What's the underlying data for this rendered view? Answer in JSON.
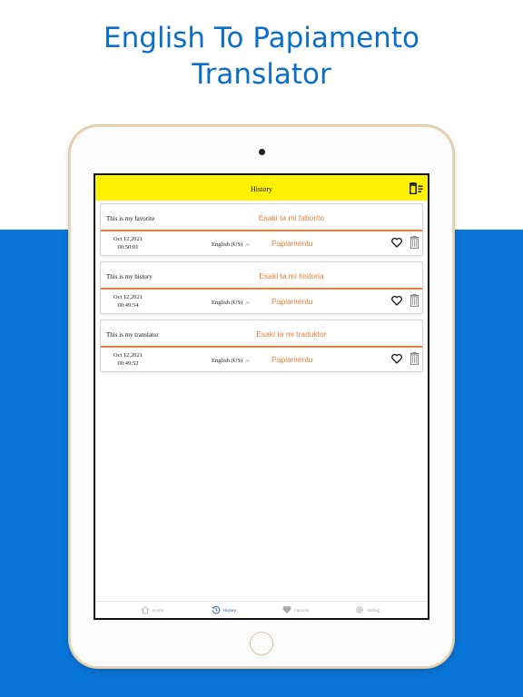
{
  "headline": {
    "line1": "English To Papiamento",
    "line2": "Translator"
  },
  "app": {
    "title": "History"
  },
  "history": [
    {
      "source": "This is my favorite",
      "translation": "Esaki ta mi faborito",
      "date": "Oct 12,2021",
      "time": "00:50:01",
      "from_lang": "English (US)",
      "arrow": "→",
      "to_lang": "Papiamentu"
    },
    {
      "source": "This is my history",
      "translation": "Esaki ta mi historia",
      "date": "Oct 12,2021",
      "time": "00:49:54",
      "from_lang": "English (US)",
      "arrow": "→",
      "to_lang": "Papiamentu"
    },
    {
      "source": "This is my translator",
      "translation": "Esaki ta mi traduktor",
      "date": "Oct 12,2021",
      "time": "00:49:52",
      "from_lang": "English (US)",
      "arrow": "→",
      "to_lang": "Papiamentu"
    }
  ],
  "tabs": [
    {
      "label": "Home",
      "icon": "home-icon"
    },
    {
      "label": "History",
      "icon": "history-icon",
      "active": true
    },
    {
      "label": "Favorite",
      "icon": "heart-icon"
    },
    {
      "label": "Setting",
      "icon": "gear-icon"
    }
  ],
  "colors": {
    "accent": "#f07e36",
    "header": "#fff200",
    "brand_blue": "#0a75d9",
    "active_tab": "#1f5fb0"
  }
}
